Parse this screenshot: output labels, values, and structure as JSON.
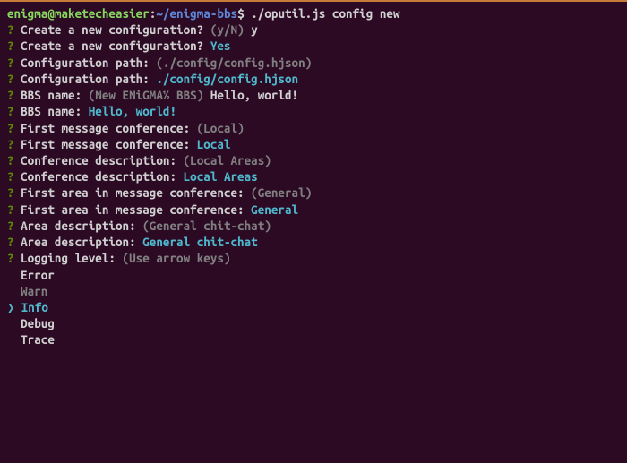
{
  "shell": {
    "user": "enigma",
    "at": "@",
    "host": "maketecheasier",
    "colon": ":",
    "cwd": "~/enigma-bbs",
    "dollar": "$",
    "command": "./oputil.js config new"
  },
  "q": "?",
  "prompts": {
    "p1": {
      "label": "Create a new configuration?",
      "hint": "(y/N)",
      "input": "y"
    },
    "p1a": {
      "label": "Create a new configuration?",
      "answer": "Yes"
    },
    "p2": {
      "label": "Configuration path:",
      "hint": "(./config/config.hjson)"
    },
    "p2a": {
      "label": "Configuration path:",
      "answer": "./config/config.hjson"
    },
    "p3": {
      "label": "BBS name:",
      "hint": "(New ENiGMA½ BBS)",
      "input": "Hello, world!"
    },
    "p3a": {
      "label": "BBS name:",
      "answer": "Hello, world!"
    },
    "p4": {
      "label": "First message conference:",
      "hint": "(Local)"
    },
    "p4a": {
      "label": "First message conference:",
      "answer": "Local"
    },
    "p5": {
      "label": "Conference description:",
      "hint": "(Local Areas)"
    },
    "p5a": {
      "label": "Conference description:",
      "answer": "Local Areas"
    },
    "p6": {
      "label": "First area in message conference:",
      "hint": "(General)"
    },
    "p6a": {
      "label": "First area in message conference:",
      "answer": "General"
    },
    "p7": {
      "label": "Area description:",
      "hint": "(General chit-chat)"
    },
    "p7a": {
      "label": "Area description:",
      "answer": "General chit-chat"
    },
    "p8": {
      "label": "Logging level:",
      "hint": "(Use arrow keys)"
    }
  },
  "list": {
    "error": "Error",
    "warn": "Warn",
    "info": "Info",
    "debug": "Debug",
    "trace": "Trace",
    "selector": "❯"
  }
}
